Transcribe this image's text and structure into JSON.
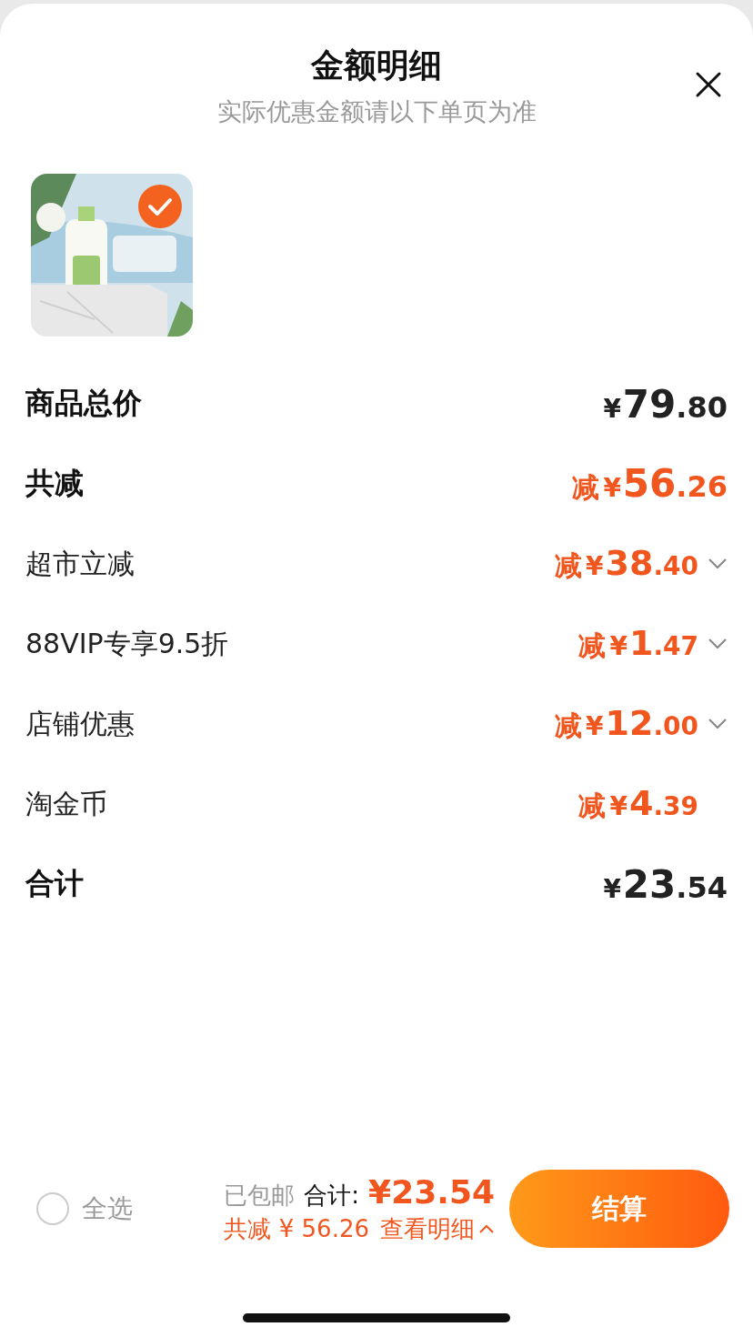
{
  "sheet": {
    "title": "金额明细",
    "subtitle": "实际优惠金额请以下单页为准"
  },
  "products": [
    {
      "kind": "picture",
      "selected": true
    }
  ],
  "rows": [
    {
      "kind": "subtotal",
      "label": "商品总价",
      "prefix": "",
      "currency": "¥",
      "amount": "79.80",
      "expandable": false
    },
    {
      "kind": "discount-total",
      "label": "共减",
      "prefix": "减",
      "currency": "¥",
      "amount": "56.26",
      "expandable": false
    },
    {
      "kind": "discount",
      "label": "超市立减",
      "prefix": "减",
      "currency": "¥",
      "amount": "38.40",
      "expandable": true
    },
    {
      "kind": "discount",
      "label": "88VIP专享9.5折",
      "prefix": "减",
      "currency": "¥",
      "amount": "1.47",
      "expandable": true
    },
    {
      "kind": "discount",
      "label": "店铺优惠",
      "prefix": "减",
      "currency": "¥",
      "amount": "12.00",
      "expandable": true
    },
    {
      "kind": "discount",
      "label": "淘金币",
      "prefix": "减",
      "currency": "¥",
      "amount": "4.39",
      "expandable": false
    },
    {
      "kind": "total",
      "label": "合计",
      "prefix": "",
      "currency": "¥",
      "amount": "23.54",
      "expandable": false
    }
  ],
  "footer": {
    "select_all": {
      "label": "全选",
      "checked": false
    },
    "shipping": "已包邮",
    "total_label": "合计:",
    "total": "¥23.54",
    "saved": "共减 ¥ 56.26",
    "details_link": "查看明细",
    "checkout": "结算"
  }
}
